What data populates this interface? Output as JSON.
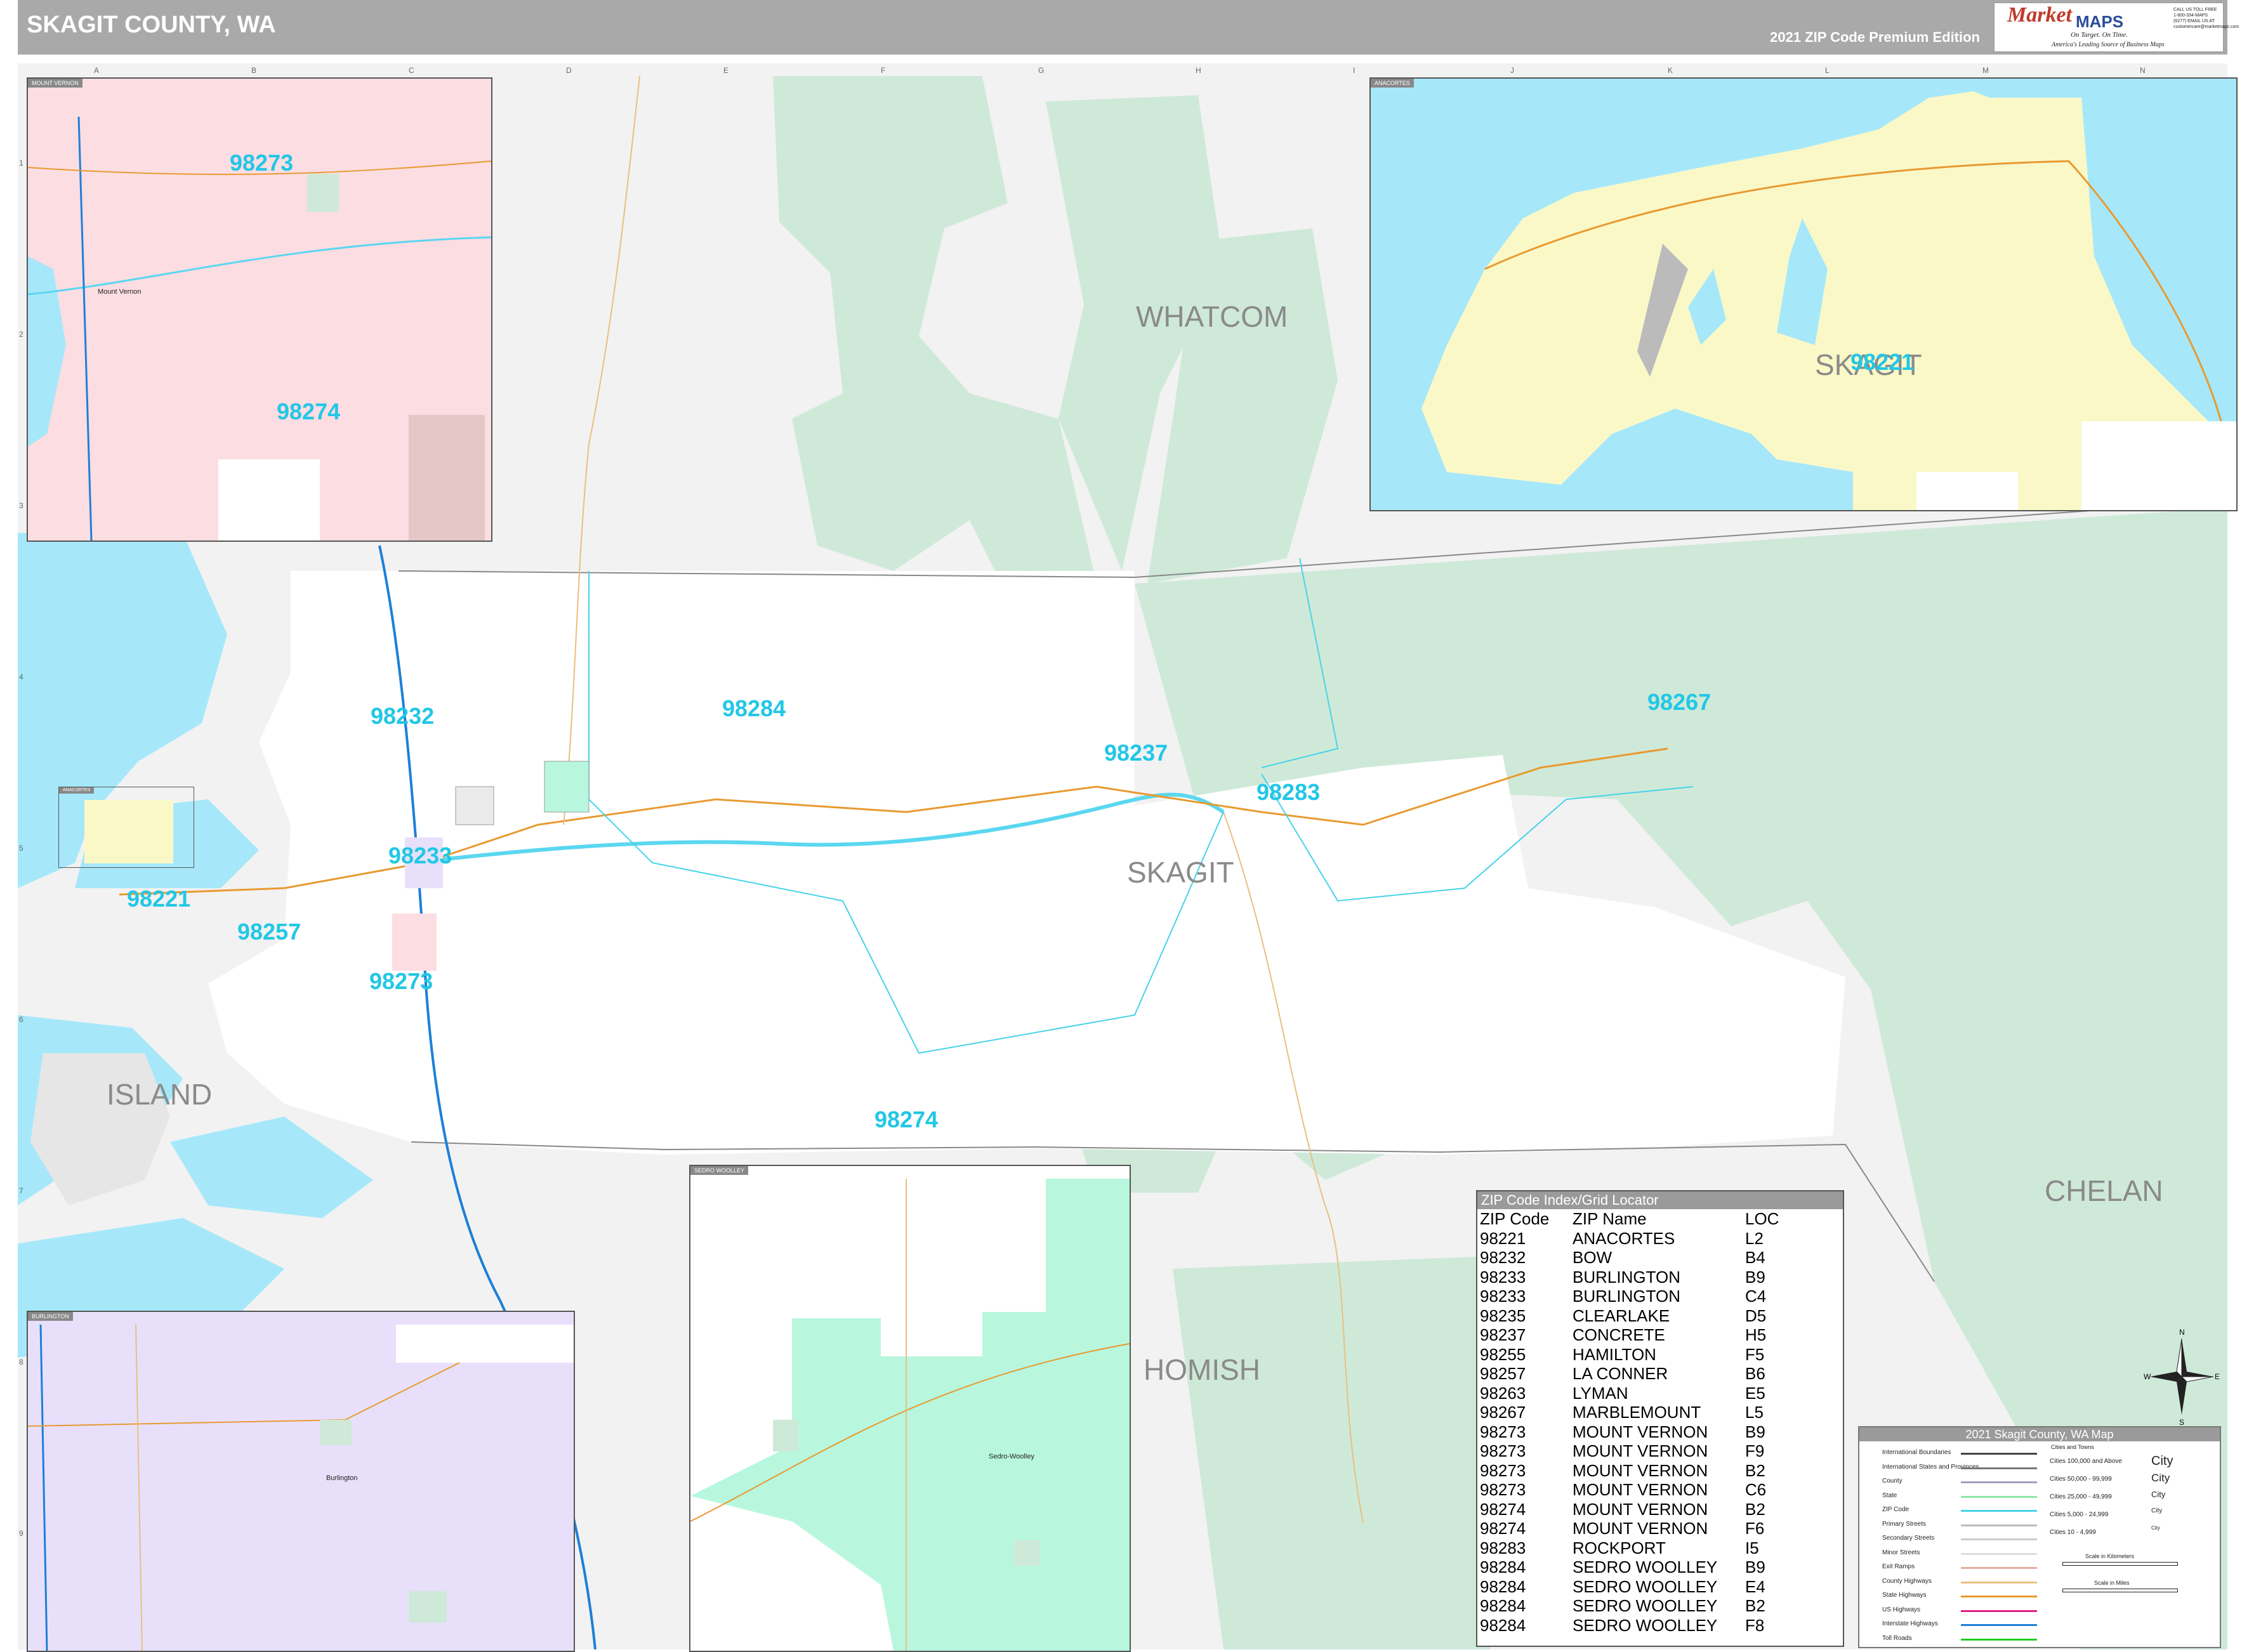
{
  "header": {
    "title": "SKAGIT COUNTY, WA",
    "edition": "2021 ZIP Code Premium Edition"
  },
  "logo": {
    "brand_part1": "Market",
    "brand_part2": "MAPS",
    "tagline1": "On Target.  On Time.",
    "tagline2": "America's Leading Source of Business Maps",
    "contact": "CALL US TOLL FREE 1-800-334-MAPS (6277)  EMAIL US AT: customercare@marketmaps.com"
  },
  "grid": {
    "columns": [
      "A",
      "B",
      "C",
      "D",
      "E",
      "F",
      "G",
      "H",
      "I",
      "J",
      "K",
      "L",
      "M",
      "N"
    ],
    "rows": [
      "1",
      "2",
      "3",
      "4",
      "5",
      "6",
      "7",
      "8",
      "9"
    ]
  },
  "insets": {
    "mount_vernon": {
      "label": "MOUNT VERNON",
      "city": "Mount Vernon",
      "zips": [
        "98273",
        "98274"
      ]
    },
    "anacortes": {
      "label": "ANACORTES",
      "county": "SKAGIT",
      "zip": "98221"
    },
    "burlington": {
      "label": "BURLINGTON",
      "city": "Burlington"
    },
    "sedro_woolley": {
      "label": "SEDRO WOOLLEY",
      "city": "Sedro-Woolley"
    },
    "small_anacortes": {
      "label": "ANACORTES"
    }
  },
  "main_zips": [
    "98232",
    "98284",
    "98237",
    "98283",
    "98267",
    "98233",
    "98221",
    "98257",
    "98273",
    "98274"
  ],
  "counties": {
    "whatcom": "WHATCOM",
    "skagit": "SKAGIT",
    "island": "ISLAND",
    "snohomish": "HOMISH",
    "chelan": "CHELAN"
  },
  "colors": {
    "water": "#a6e8fa",
    "forest": "#cfe9d9",
    "neighbor": "#f2f2f2",
    "zip_label": "#22c7e6",
    "mount_vernon_inset": "#fcdde2",
    "anacortes_inset": "#fbf8c8",
    "burlington_inset": "#e8e0fb",
    "sedro_inset": "#b8f7de"
  },
  "index": {
    "title": "ZIP Code Index/Grid Locator",
    "headers": [
      "ZIP Code",
      "ZIP Name",
      "LOC"
    ],
    "rows": [
      [
        "98221",
        "ANACORTES",
        "L2"
      ],
      [
        "98232",
        "BOW",
        "B4"
      ],
      [
        "98233",
        "BURLINGTON",
        "B9"
      ],
      [
        "98233",
        "BURLINGTON",
        "C4"
      ],
      [
        "98235",
        "CLEARLAKE",
        "D5"
      ],
      [
        "98237",
        "CONCRETE",
        "H5"
      ],
      [
        "98255",
        "HAMILTON",
        "F5"
      ],
      [
        "98257",
        "LA CONNER",
        "B6"
      ],
      [
        "98263",
        "LYMAN",
        "E5"
      ],
      [
        "98267",
        "MARBLEMOUNT",
        "L5"
      ],
      [
        "98273",
        "MOUNT VERNON",
        "B9"
      ],
      [
        "98273",
        "MOUNT VERNON",
        "F9"
      ],
      [
        "98273",
        "MOUNT VERNON",
        "B2"
      ],
      [
        "98273",
        "MOUNT VERNON",
        "C6"
      ],
      [
        "98274",
        "MOUNT VERNON",
        "B2"
      ],
      [
        "98274",
        "MOUNT VERNON",
        "F6"
      ],
      [
        "98283",
        "ROCKPORT",
        "I5"
      ],
      [
        "98284",
        "SEDRO WOOLLEY",
        "B9"
      ],
      [
        "98284",
        "SEDRO WOOLLEY",
        "E4"
      ],
      [
        "98284",
        "SEDRO WOOLLEY",
        "B2"
      ],
      [
        "98284",
        "SEDRO WOOLLEY",
        "F8"
      ]
    ]
  },
  "legend": {
    "title": "2021 Skagit County, WA Map",
    "lines": [
      {
        "label": "International Boundaries",
        "color": "#444444"
      },
      {
        "label": "International States and Provinces",
        "color": "#777777"
      },
      {
        "label": "County",
        "color": "#a0a0c0"
      },
      {
        "label": "State",
        "color": "#8ee6a8"
      },
      {
        "label": "ZIP Code",
        "color": "#47d3e8"
      },
      {
        "label": "Primary Streets",
        "color": "#bbbbbb"
      },
      {
        "label": "Secondary Streets",
        "color": "#cccccc"
      },
      {
        "label": "Minor Streets",
        "color": "#dddddd"
      },
      {
        "label": "Exit Ramps",
        "color": "#e0b0a0"
      },
      {
        "label": "County Highways",
        "color": "#e8c080"
      },
      {
        "label": "State Highways",
        "color": "#e89a30"
      },
      {
        "label": "US Highways",
        "color": "#e0208a"
      },
      {
        "label": "Interstate Highways",
        "color": "#1e7fd8"
      },
      {
        "label": "Toll Roads",
        "color": "#22cc22"
      }
    ],
    "cities_title": "Cities and Towns",
    "cities": [
      {
        "label": "Cities 100,000 and Above",
        "sample": "City"
      },
      {
        "label": "Cities 50,000 - 99,999",
        "sample": "City"
      },
      {
        "label": "Cities 25,000 - 49,999",
        "sample": "City"
      },
      {
        "label": "Cities 5,000 - 24,999",
        "sample": "City"
      },
      {
        "label": "Cities 10 - 4,999",
        "sample": "City"
      }
    ],
    "scale_km": "Scale in Kilometers",
    "scale_mi": "Scale in Miles"
  },
  "compass": {
    "n": "N",
    "s": "S",
    "e": "E",
    "w": "W"
  }
}
